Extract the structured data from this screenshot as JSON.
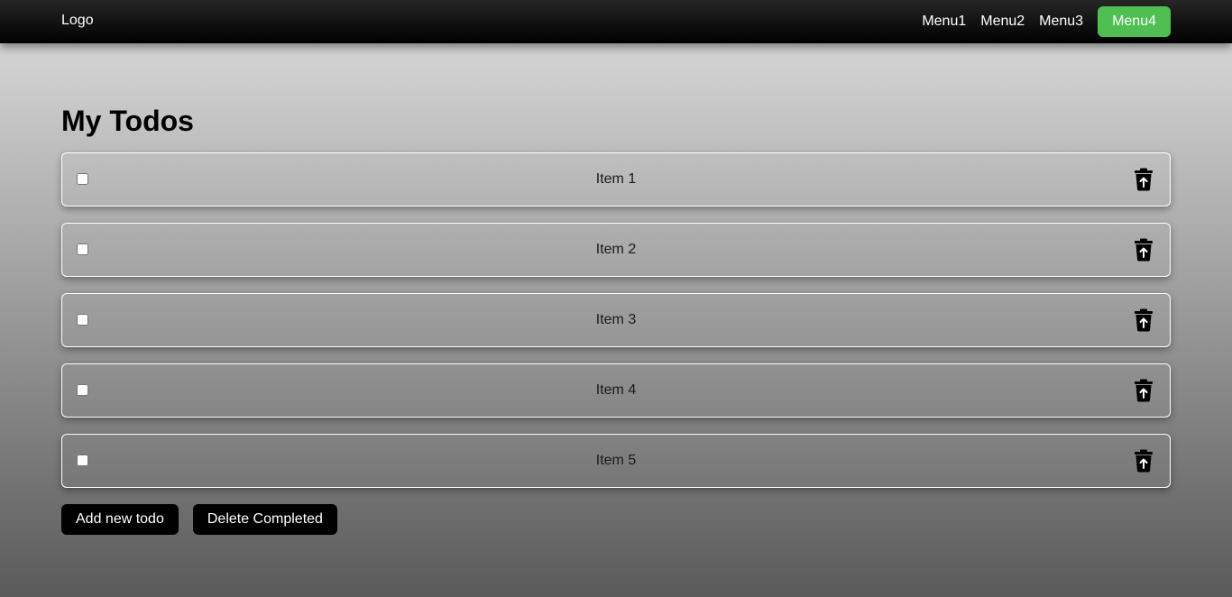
{
  "navbar": {
    "logo": "Logo",
    "menu": [
      {
        "label": "Menu1",
        "active": false
      },
      {
        "label": "Menu2",
        "active": false
      },
      {
        "label": "Menu3",
        "active": false
      },
      {
        "label": "Menu4",
        "active": true
      }
    ],
    "active_color": "#4fbf52"
  },
  "page": {
    "title": "My Todos"
  },
  "todos": [
    {
      "label": "Item 1",
      "checked": false,
      "icon": "trash-icon"
    },
    {
      "label": "Item 2",
      "checked": false,
      "icon": "trash-icon"
    },
    {
      "label": "Item 3",
      "checked": false,
      "icon": "trash-icon"
    },
    {
      "label": "Item 4",
      "checked": false,
      "icon": "trash-icon"
    },
    {
      "label": "Item 5",
      "checked": false,
      "icon": "trash-icon"
    }
  ],
  "actions": {
    "add_label": "Add new todo",
    "delete_completed_label": "Delete Completed"
  }
}
